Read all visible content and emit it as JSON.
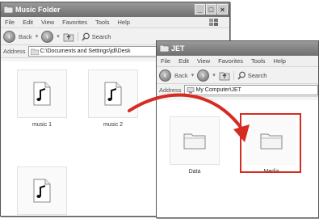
{
  "music_window": {
    "title": "Music Folder",
    "menu": [
      "File",
      "Edit",
      "View",
      "Favorites",
      "Tools",
      "Help"
    ],
    "back_label": "Back",
    "search_label": "Search",
    "address_label": "Address",
    "address_value": "C:\\Documents and Settings\\jdl\\Desk",
    "files": [
      {
        "name": "music 1"
      },
      {
        "name": "music 2"
      },
      {
        "name": ""
      }
    ]
  },
  "jet_window": {
    "title": "JET",
    "menu": [
      "File",
      "Edit",
      "View",
      "Favorites",
      "Tools",
      "Help"
    ],
    "back_label": "Back",
    "search_label": "Search",
    "address_label": "Address",
    "address_value": "My Computer\\JET",
    "folders": [
      {
        "name": "Data"
      },
      {
        "name": "Media"
      }
    ]
  },
  "colors": {
    "highlight": "#d62b22",
    "titlebar": "#7a7a7a"
  },
  "icons": [
    "folder-icon",
    "music-file-icon",
    "back-arrow-icon",
    "forward-arrow-icon",
    "up-folder-icon",
    "search-icon",
    "windows-logo-icon",
    "drag-arrow-icon"
  ]
}
